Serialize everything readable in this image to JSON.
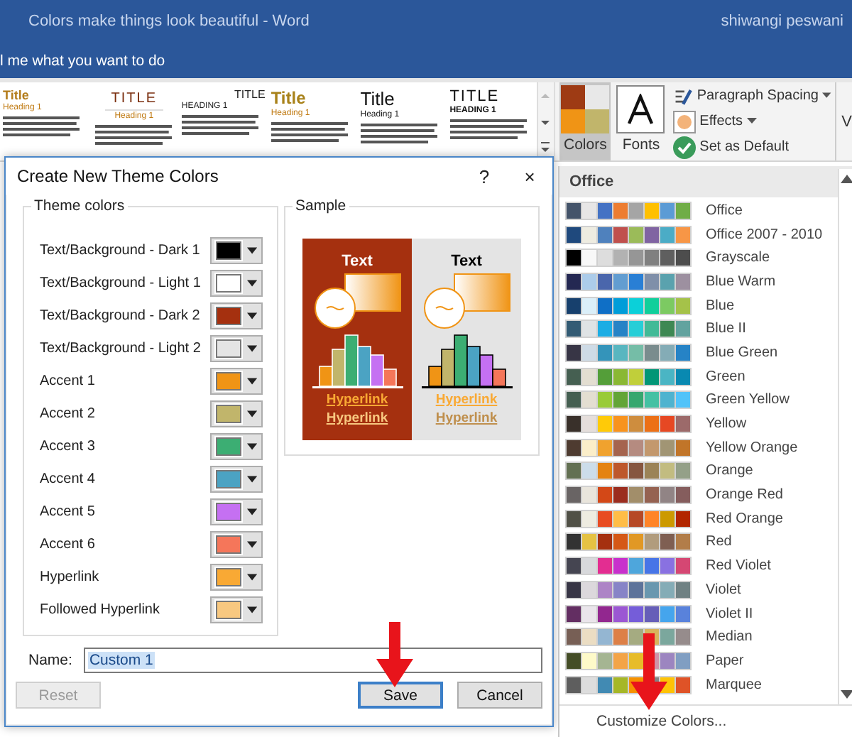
{
  "window": {
    "title": "Colors make things look beautiful  -  Word",
    "user": "shiwangi peswani"
  },
  "tell_me": "l me what you want to do",
  "style_gallery": [
    {
      "kind": "classic",
      "title": "Title",
      "heading": "Heading 1"
    },
    {
      "kind": "centered",
      "title": "TITLE",
      "heading": "Heading 1"
    },
    {
      "kind": "smallcaps",
      "title": "TITLE",
      "heading": "HEADING 1"
    },
    {
      "kind": "golden",
      "title": "Title",
      "heading": "Heading 1"
    },
    {
      "kind": "plain",
      "title": "Title",
      "heading": "Heading 1"
    },
    {
      "kind": "caps",
      "title": "TITLE",
      "heading": "HEADING 1"
    }
  ],
  "theme_buttons": [
    {
      "kind": "colors",
      "label": "Colors",
      "selected": true
    },
    {
      "kind": "fonts",
      "label": "Fonts",
      "selected": false
    }
  ],
  "design_commands": [
    {
      "kind": "spacing",
      "label": "Paragraph Spacing",
      "dropdown": true
    },
    {
      "kind": "effects",
      "label": "Effects",
      "dropdown": true
    },
    {
      "kind": "default",
      "label": "Set as Default",
      "dropdown": false
    }
  ],
  "cut_label": "V",
  "dialog": {
    "title": "Create New Theme Colors",
    "help": "?",
    "close": "×",
    "theme_group": "Theme colors",
    "theme_colors": [
      {
        "label": "Text/Background - Dark 1",
        "color": "#000000"
      },
      {
        "label": "Text/Background - Light 1",
        "color": "#ffffff"
      },
      {
        "label": "Text/Background - Dark 2",
        "color": "#a5300f"
      },
      {
        "label": "Text/Background - Light 2",
        "color": "#e4e4e4"
      },
      {
        "label": "Accent 1",
        "color": "#f09415"
      },
      {
        "label": "Accent 2",
        "color": "#c1b56b"
      },
      {
        "label": "Accent 3",
        "color": "#3cae73"
      },
      {
        "label": "Accent 4",
        "color": "#4ba3c3"
      },
      {
        "label": "Accent 5",
        "color": "#c570f2"
      },
      {
        "label": "Accent 6",
        "color": "#f5765a"
      },
      {
        "label": "Hyperlink",
        "color": "#f9a934"
      },
      {
        "label": "Followed Hyperlink",
        "color": "#f8c880"
      }
    ],
    "sample_group": "Sample",
    "sample_panels": [
      {
        "text": "Text",
        "hyperlink": "Hyperlink",
        "followed_hyperlink": "Hyperlink"
      },
      {
        "text": "Text",
        "hyperlink": "Hyperlink",
        "followed_hyperlink": "Hyperlink"
      }
    ],
    "name_label": "Name:",
    "name_value": "Custom 1",
    "buttons": [
      {
        "label": "Reset",
        "disabled": true,
        "default": false
      },
      {
        "label": "Save",
        "disabled": false,
        "default": true
      },
      {
        "label": "Cancel",
        "disabled": false,
        "default": false
      }
    ]
  },
  "palette": {
    "header": "Office",
    "footer": "Customize Colors...",
    "schemes": [
      {
        "name": "Office",
        "colors": [
          {
            "color": "#44546a"
          },
          {
            "color": "#e7e6e6"
          },
          {
            "color": "#4472c4"
          },
          {
            "color": "#ed7d31"
          },
          {
            "color": "#a5a5a5"
          },
          {
            "color": "#ffc000"
          },
          {
            "color": "#5b9bd5"
          },
          {
            "color": "#70ad47"
          }
        ]
      },
      {
        "name": "Office 2007 - 2010",
        "colors": [
          {
            "color": "#1f497d"
          },
          {
            "color": "#eeece1"
          },
          {
            "color": "#4f81bd"
          },
          {
            "color": "#c0504d"
          },
          {
            "color": "#9bbb59"
          },
          {
            "color": "#8064a2"
          },
          {
            "color": "#4bacc6"
          },
          {
            "color": "#f79646"
          }
        ]
      },
      {
        "name": "Grayscale",
        "colors": [
          {
            "color": "#000000"
          },
          {
            "color": "#f8f8f8"
          },
          {
            "color": "#dddddd"
          },
          {
            "color": "#b2b2b2"
          },
          {
            "color": "#969696"
          },
          {
            "color": "#808080"
          },
          {
            "color": "#5f5f5f"
          },
          {
            "color": "#4d4d4d"
          }
        ]
      },
      {
        "name": "Blue Warm",
        "colors": [
          {
            "color": "#242852"
          },
          {
            "color": "#acccea"
          },
          {
            "color": "#4a66ac"
          },
          {
            "color": "#629dd1"
          },
          {
            "color": "#297fd5"
          },
          {
            "color": "#7f8fa9"
          },
          {
            "color": "#5aa2ae"
          },
          {
            "color": "#9d90a0"
          }
        ]
      },
      {
        "name": "Blue",
        "colors": [
          {
            "color": "#17406d"
          },
          {
            "color": "#dbeff9"
          },
          {
            "color": "#0f6fc6"
          },
          {
            "color": "#009dd9"
          },
          {
            "color": "#0bd0d9"
          },
          {
            "color": "#10cf9b"
          },
          {
            "color": "#7cca62"
          },
          {
            "color": "#a5c249"
          }
        ]
      },
      {
        "name": "Blue II",
        "colors": [
          {
            "color": "#335b74"
          },
          {
            "color": "#dfe3e5"
          },
          {
            "color": "#1cade4"
          },
          {
            "color": "#2683c6"
          },
          {
            "color": "#27ced7"
          },
          {
            "color": "#42ba97"
          },
          {
            "color": "#3e8853"
          },
          {
            "color": "#62a39f"
          }
        ]
      },
      {
        "name": "Blue Green",
        "colors": [
          {
            "color": "#373545"
          },
          {
            "color": "#cedbe6"
          },
          {
            "color": "#3494ba"
          },
          {
            "color": "#58b6c0"
          },
          {
            "color": "#75bda7"
          },
          {
            "color": "#7a8c8e"
          },
          {
            "color": "#84acb6"
          },
          {
            "color": "#2683c6"
          }
        ]
      },
      {
        "name": "Green",
        "colors": [
          {
            "color": "#455f51"
          },
          {
            "color": "#e3ded1"
          },
          {
            "color": "#549e39"
          },
          {
            "color": "#8ab833"
          },
          {
            "color": "#c0cf3a"
          },
          {
            "color": "#029676"
          },
          {
            "color": "#4ab5c4"
          },
          {
            "color": "#0989b1"
          }
        ]
      },
      {
        "name": "Green Yellow",
        "colors": [
          {
            "color": "#455f51"
          },
          {
            "color": "#e3ded1"
          },
          {
            "color": "#99cb38"
          },
          {
            "color": "#63a537"
          },
          {
            "color": "#37a76f"
          },
          {
            "color": "#44c1a3"
          },
          {
            "color": "#4eb3cf"
          },
          {
            "color": "#51c3f9"
          }
        ]
      },
      {
        "name": "Yellow",
        "colors": [
          {
            "color": "#39302a"
          },
          {
            "color": "#e5dedb"
          },
          {
            "color": "#ffca08"
          },
          {
            "color": "#f8931d"
          },
          {
            "color": "#ce8d3e"
          },
          {
            "color": "#ec7016"
          },
          {
            "color": "#e64823"
          },
          {
            "color": "#9c6a6a"
          }
        ]
      },
      {
        "name": "Yellow Orange",
        "colors": [
          {
            "color": "#4e3b30"
          },
          {
            "color": "#fbeec9"
          },
          {
            "color": "#f0a22e"
          },
          {
            "color": "#a5644e"
          },
          {
            "color": "#b58b80"
          },
          {
            "color": "#c3986d"
          },
          {
            "color": "#a19574"
          },
          {
            "color": "#c17529"
          }
        ]
      },
      {
        "name": "Orange",
        "colors": [
          {
            "color": "#637052"
          },
          {
            "color": "#ccddea"
          },
          {
            "color": "#e48312"
          },
          {
            "color": "#bd582c"
          },
          {
            "color": "#865640"
          },
          {
            "color": "#9b8357"
          },
          {
            "color": "#c2bc80"
          },
          {
            "color": "#94a088"
          }
        ]
      },
      {
        "name": "Orange Red",
        "colors": [
          {
            "color": "#696464"
          },
          {
            "color": "#e9e5dc"
          },
          {
            "color": "#d34817"
          },
          {
            "color": "#9b2d1f"
          },
          {
            "color": "#a28e6a"
          },
          {
            "color": "#956251"
          },
          {
            "color": "#918485"
          },
          {
            "color": "#855d5d"
          }
        ]
      },
      {
        "name": "Red Orange",
        "colors": [
          {
            "color": "#505046"
          },
          {
            "color": "#eeece1"
          },
          {
            "color": "#e84c22"
          },
          {
            "color": "#ffbd47"
          },
          {
            "color": "#b64926"
          },
          {
            "color": "#ff8427"
          },
          {
            "color": "#cc9900"
          },
          {
            "color": "#b22600"
          }
        ]
      },
      {
        "name": "Red",
        "colors": [
          {
            "color": "#323232"
          },
          {
            "color": "#e5c243"
          },
          {
            "color": "#a5300f"
          },
          {
            "color": "#d55816"
          },
          {
            "color": "#e19825"
          },
          {
            "color": "#b19c7d"
          },
          {
            "color": "#7f5f52"
          },
          {
            "color": "#b27d49"
          }
        ]
      },
      {
        "name": "Red Violet",
        "colors": [
          {
            "color": "#454551"
          },
          {
            "color": "#d8d9dc"
          },
          {
            "color": "#e32d91"
          },
          {
            "color": "#c830cc"
          },
          {
            "color": "#4ea6dc"
          },
          {
            "color": "#4775e7"
          },
          {
            "color": "#8971e1"
          },
          {
            "color": "#d54773"
          }
        ]
      },
      {
        "name": "Violet",
        "colors": [
          {
            "color": "#373545"
          },
          {
            "color": "#dcd8dc"
          },
          {
            "color": "#ad84c6"
          },
          {
            "color": "#8784c7"
          },
          {
            "color": "#5d739a"
          },
          {
            "color": "#6997af"
          },
          {
            "color": "#84acb6"
          },
          {
            "color": "#6f8183"
          }
        ]
      },
      {
        "name": "Violet II",
        "colors": [
          {
            "color": "#632e62"
          },
          {
            "color": "#eae5eb"
          },
          {
            "color": "#92278f"
          },
          {
            "color": "#9b57d3"
          },
          {
            "color": "#755dd9"
          },
          {
            "color": "#665eb8"
          },
          {
            "color": "#45a5ed"
          },
          {
            "color": "#5982db"
          }
        ]
      },
      {
        "name": "Median",
        "colors": [
          {
            "color": "#775f55"
          },
          {
            "color": "#ebddc3"
          },
          {
            "color": "#94b6d2"
          },
          {
            "color": "#dd8047"
          },
          {
            "color": "#a5ab81"
          },
          {
            "color": "#d8b25c"
          },
          {
            "color": "#7ba79d"
          },
          {
            "color": "#968c8c"
          }
        ]
      },
      {
        "name": "Paper",
        "colors": [
          {
            "color": "#444d26"
          },
          {
            "color": "#fefac9"
          },
          {
            "color": "#a5b592"
          },
          {
            "color": "#f3a447"
          },
          {
            "color": "#e7bc29"
          },
          {
            "color": "#d092a7"
          },
          {
            "color": "#9c85c0"
          },
          {
            "color": "#809ec2"
          }
        ]
      },
      {
        "name": "Marquee",
        "colors": [
          {
            "color": "#5e5e5e"
          },
          {
            "color": "#dddddd"
          },
          {
            "color": "#418ab3"
          },
          {
            "color": "#a6b727"
          },
          {
            "color": "#f69200"
          },
          {
            "color": "#838383"
          },
          {
            "color": "#fec306"
          },
          {
            "color": "#df5327"
          }
        ]
      }
    ]
  }
}
